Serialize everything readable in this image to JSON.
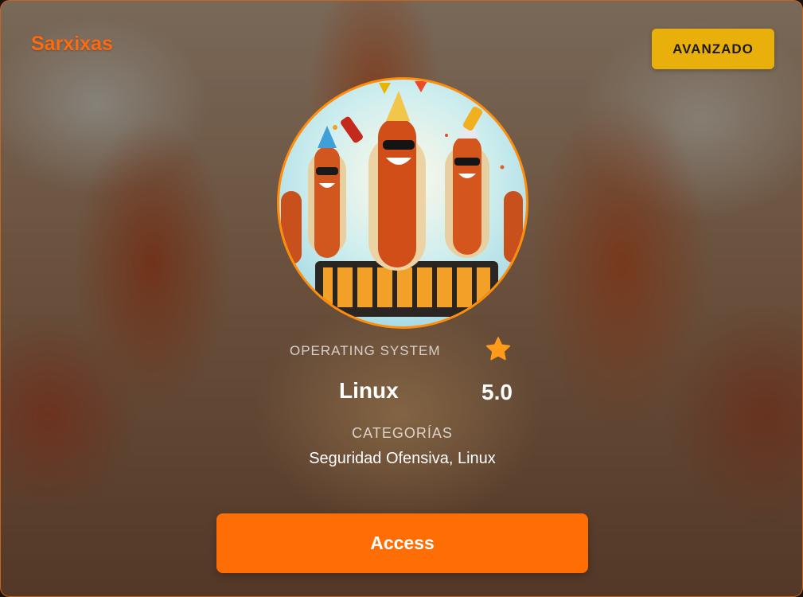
{
  "header": {
    "title": "Sarxixas",
    "difficulty_badge": "AVANZADO"
  },
  "details": {
    "os_label": "OPERATING SYSTEM",
    "os_value": "Linux",
    "rating": "5.0",
    "categories_label": "CATEGORÍAS",
    "categories_value": "Seguridad Ofensiva, Linux"
  },
  "actions": {
    "access_label": "Access"
  },
  "icons": {
    "rating": "star-icon"
  },
  "colors": {
    "accent_orange": "#ff6d05",
    "title_orange": "#ff6a10",
    "badge_yellow": "#e9b00c",
    "star": "#ff9a1a"
  }
}
